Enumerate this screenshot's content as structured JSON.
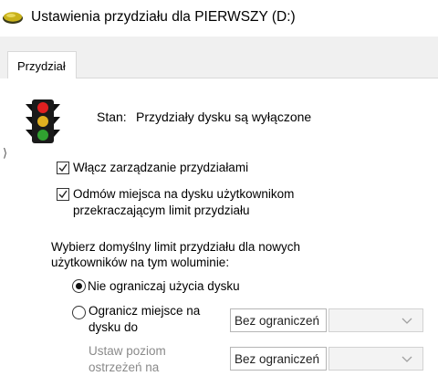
{
  "window": {
    "title": "Ustawienia przydziału dla PIERWSZY (D:)",
    "icon": "drive-icon"
  },
  "tabs": [
    {
      "label": "Przydział",
      "selected": true
    }
  ],
  "status": {
    "icon": "traffic-light-icon",
    "label": "Stan:",
    "text": "Przydziały dysku są wyłączone"
  },
  "options": {
    "enable_quota": {
      "label": "Włącz zarządzanie przydziałami",
      "checked": true
    },
    "deny_space": {
      "line1": "Odmów miejsca na dysku użytkownikom",
      "line2": "przekraczającym limit przydziału",
      "checked": true
    }
  },
  "default_limit": {
    "line1": "Wybierz domyślny limit przydziału dla nowych",
    "line2": "użytkowników na tym woluminie:",
    "no_limit": {
      "label": "Nie ograniczaj użycia dysku",
      "selected": true
    },
    "limit_space": {
      "line1": "Ogranicz miejsce na",
      "line2": "dysku do",
      "selected": false,
      "value": "Bez ograniczeń",
      "unit": ""
    },
    "warning_level": {
      "line1": "Ustaw poziom",
      "line2": "ostrzeżeń na",
      "value": "Bez ograniczeń",
      "unit": ""
    }
  }
}
